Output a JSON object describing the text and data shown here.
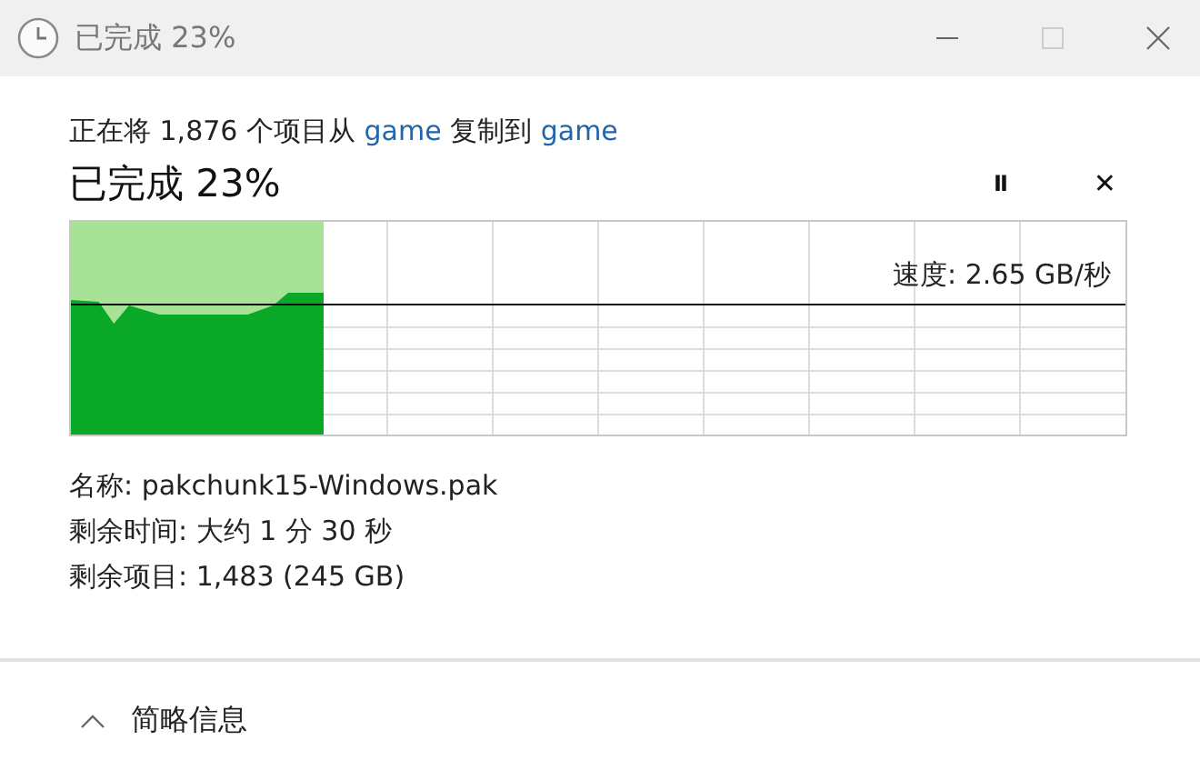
{
  "window": {
    "title": "已完成 23%"
  },
  "summary": [
    {
      "kind": "text",
      "text": "正在将 1,876 个项目从 "
    },
    {
      "kind": "link",
      "text": "game"
    },
    {
      "kind": "text",
      "text": " 复制到 "
    },
    {
      "kind": "link",
      "text": "game"
    }
  ],
  "heading": "已完成 23%",
  "buttons": [
    {
      "kind": "pause",
      "label": "II"
    },
    {
      "kind": "cancel",
      "label": "✕"
    }
  ],
  "progress": {
    "level": 0.24,
    "speed": "速度: 2.65 GB/秒"
  },
  "details": [
    "名称: pakchunk15-Windows.pak",
    "剩余时间: 大约 1 分 30 秒",
    "剩余项目: 1,483 (245 GB)"
  ],
  "footer": {
    "label": "简略信息",
    "expanded": true
  }
}
